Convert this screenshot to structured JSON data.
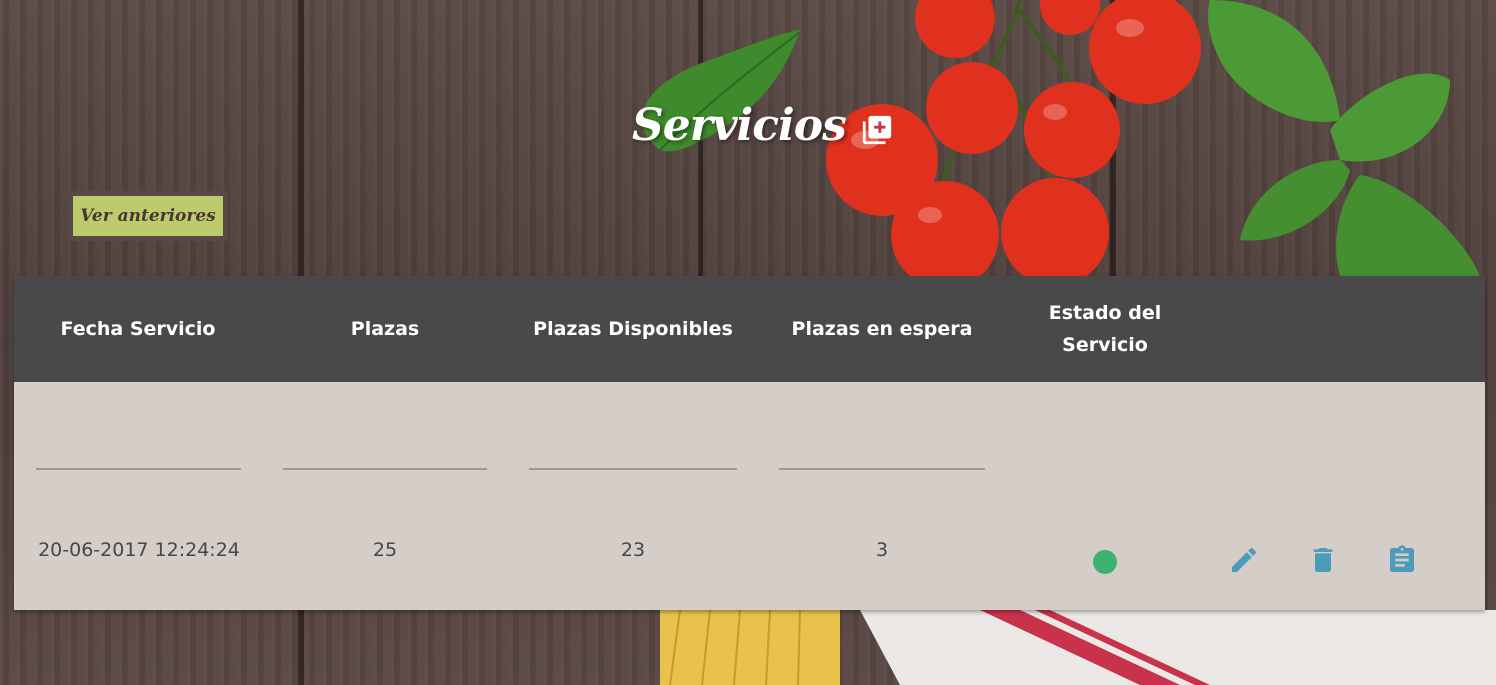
{
  "header": {
    "title": "Servicios",
    "add_icon": "add-box-icon"
  },
  "toolbar": {
    "previous_label": "Ver anteriores"
  },
  "table": {
    "columns": [
      "Fecha Servicio",
      "Plazas",
      "Plazas Disponibles",
      "Plazas en espera",
      "Estado del Servicio"
    ],
    "filters": [
      "",
      "",
      "",
      ""
    ],
    "rows": [
      {
        "fecha": "20-06-2017 12:24:24",
        "plazas": "25",
        "disponibles": "23",
        "espera": "3",
        "estado_color": "#3cb371",
        "actions": [
          "edit-icon",
          "delete-icon",
          "clipboard-icon"
        ]
      }
    ]
  },
  "colors": {
    "header_bg": "#494949",
    "table_bg": "#d5cdc7",
    "button_bg": "#bccb6b",
    "icon_accent": "#4a9cb8",
    "status_active": "#3cb371"
  }
}
